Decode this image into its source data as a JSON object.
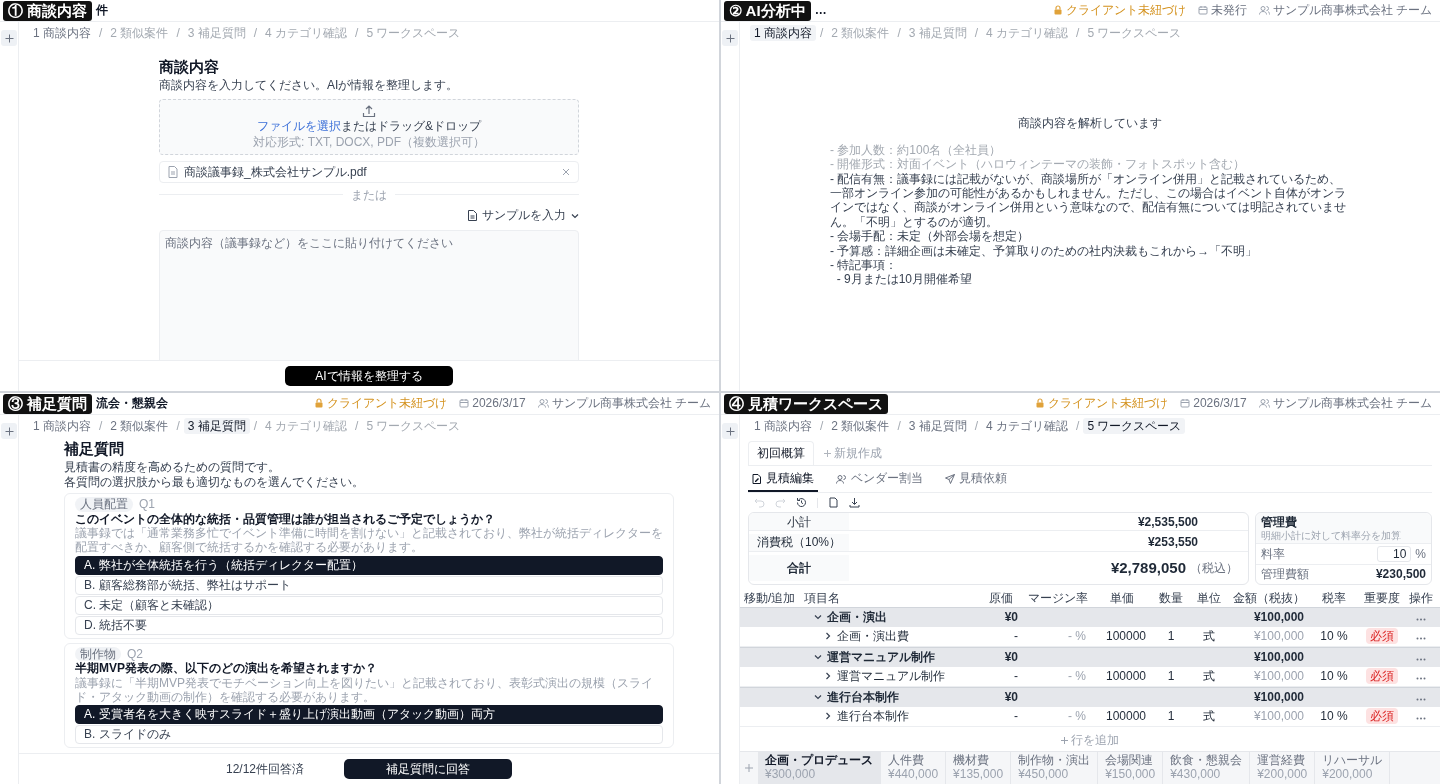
{
  "panels": [
    {
      "kind": "input",
      "label": "① 商談内容",
      "title_tail": "件",
      "step_separator": "/",
      "steps": [
        {
          "label": "1 商談内容",
          "selected": false,
          "disabled": false
        },
        {
          "label": "2 類似案件",
          "selected": false,
          "disabled": true
        },
        {
          "label": "3 補足質問",
          "selected": false,
          "disabled": true
        },
        {
          "label": "4 カテゴリ確認",
          "selected": false,
          "disabled": true
        },
        {
          "label": "5 ワークスペース",
          "selected": false,
          "disabled": true
        }
      ],
      "heading": "商談内容",
      "description": "商談内容を入力してください。AIが情報を整理します。",
      "dropzone": {
        "link": "ファイルを選択",
        "text": "またはドラッグ&ドロップ",
        "hint": "対応形式: TXT, DOCX, PDF（複数選択可）"
      },
      "file": {
        "name": "商談議事録_株式会社サンプル.pdf"
      },
      "divider": "または",
      "sample_button": "サンプルを入力",
      "textarea": {
        "placeholder": "商談内容（議事録など）をここに貼り付けてください"
      },
      "footer_button": "AIで情報を整理する"
    },
    {
      "kind": "analyzing",
      "label": "② AI分析中",
      "title_tail": "…",
      "step_separator": "/",
      "header_items": [
        {
          "kind": "client",
          "text": "クライアント未紐づけ"
        },
        {
          "kind": "date",
          "text": "未発行"
        },
        {
          "kind": "team",
          "text": "サンプル商事株式会社 チーム"
        }
      ],
      "steps": [
        {
          "label": "1 商談内容",
          "selected": true,
          "disabled": false
        },
        {
          "label": "2 類似案件",
          "selected": false,
          "disabled": true
        },
        {
          "label": "3 補足質問",
          "selected": false,
          "disabled": true
        },
        {
          "label": "4 カテゴリ確認",
          "selected": false,
          "disabled": true
        },
        {
          "label": "5 ワークスペース",
          "selected": false,
          "disabled": true
        }
      ],
      "heading": "商談内容を解析しています",
      "lines": [
        {
          "text": "- 参加人数：約100名（全社員）",
          "faded": true
        },
        {
          "text": "- 開催形式：対面イベント（ハロウィンテーマの装飾・フォトスポット含む）",
          "faded": true
        },
        {
          "text": "- 配信有無：議事録には記載がないが、商談場所が「オンライン併用」と記載されているため、一部オンライン参加の可能性があるかもしれません。ただし、この場合はイベント自体がオンラインではなく、商談がオンライン併用という意味なので、配信有無については明記されていません。「不明」とするのが適切。",
          "faded": false
        },
        {
          "text": "- 会場手配：未定（外部会場を想定）",
          "faded": false
        },
        {
          "text": "- 予算感：詳細企画は未確定、予算取りのための社内決裁もこれから→「不明」",
          "faded": false
        },
        {
          "text": "- 特記事項：",
          "faded": false
        },
        {
          "text": "  - 9月または10月開催希望",
          "faded": false
        }
      ]
    },
    {
      "kind": "questions",
      "label": "③ 補足質問",
      "title_tail": "流会・懇親会",
      "step_separator": "/",
      "header_items": [
        {
          "kind": "client",
          "text": "クライアント未紐づけ"
        },
        {
          "kind": "date",
          "text": "2026/3/17"
        },
        {
          "kind": "team",
          "text": "サンプル商事株式会社 チーム"
        }
      ],
      "steps": [
        {
          "label": "1 商談内容",
          "selected": false,
          "disabled": false
        },
        {
          "label": "2 類似案件",
          "selected": false,
          "disabled": false
        },
        {
          "label": "3 補足質問",
          "selected": true,
          "disabled": false
        },
        {
          "label": "4 カテゴリ確認",
          "selected": false,
          "disabled": true
        },
        {
          "label": "5 ワークスペース",
          "selected": false,
          "disabled": true
        }
      ],
      "heading": "補足質問",
      "description_lines": [
        "見積書の精度を高めるための質問です。",
        "各質問の選択肢から最も適切なものを選んでください。"
      ],
      "questions": [
        {
          "tag": "人員配置",
          "number": "Q1",
          "question": "このイベントの全体的な統括・品質管理は誰が担当されるご予定でしょうか？",
          "note": "議事録では「通常業務多忙でイベント準備に時間を割けない」と記載されており、弊社が統括ディレクターを配置すべきか、顧客側で統括するかを確認する必要があります。",
          "options": [
            {
              "label": "A. 弊社が全体統括を行う（統括ディレクター配置）",
              "selected": true
            },
            {
              "label": "B. 顧客総務部が統括、弊社はサポート",
              "selected": false
            },
            {
              "label": "C. 未定（顧客と未確認）",
              "selected": false
            },
            {
              "label": "D. 統括不要",
              "selected": false
            }
          ]
        },
        {
          "tag": "制作物",
          "number": "Q2",
          "question": "半期MVP発表の際、以下のどの演出を希望されますか？",
          "note": "議事録に「半期MVP発表でモチベーション向上を図りたい」と記載されており、表彰式演出の規模（スライド・アタック動画の制作）を確認する必要があります。",
          "options": [
            {
              "label": "A. 受賞者名を大きく映すスライド＋盛り上げ演出動画（アタック動画）両方",
              "selected": true
            },
            {
              "label": "B. スライドのみ",
              "selected": false
            }
          ]
        }
      ],
      "answered": "12/12件回答済",
      "footer_button": "補足質問に回答"
    },
    {
      "kind": "workspace",
      "label": "④ 見積ワークスペース",
      "step_separator": "/",
      "header_items": [
        {
          "kind": "client",
          "text": "クライアント未紐づけ"
        },
        {
          "kind": "date",
          "text": "2026/3/17"
        },
        {
          "kind": "team",
          "text": "サンプル商事株式会社 チーム"
        }
      ],
      "steps": [
        {
          "label": "1 商談内容",
          "selected": false,
          "disabled": false
        },
        {
          "label": "2 類似案件",
          "selected": false,
          "disabled": false
        },
        {
          "label": "3 補足質問",
          "selected": false,
          "disabled": false
        },
        {
          "label": "4 カテゴリ確認",
          "selected": false,
          "disabled": false
        },
        {
          "label": "5 ワークスペース",
          "selected": true,
          "disabled": false
        }
      ],
      "estimate_tabs": [
        {
          "label": "初回概算",
          "selected": true
        }
      ],
      "new_tab": "新規作成",
      "sub_tabs": [
        {
          "label": "見積編集",
          "selected": true
        },
        {
          "label": "ベンダー割当",
          "selected": false
        },
        {
          "label": "見積依頼",
          "selected": false
        }
      ],
      "toolbar_buttons": [
        {
          "kind": "undo",
          "disabled": true
        },
        {
          "kind": "redo",
          "disabled": true
        },
        {
          "kind": "history",
          "disabled": false
        },
        {
          "kind": "copy",
          "disabled": false
        },
        {
          "kind": "download",
          "disabled": false
        }
      ],
      "summary": [
        {
          "kind": "normal",
          "label": "小計",
          "value": "¥2,535,500"
        },
        {
          "kind": "normal",
          "label": "消費税（10%）",
          "value": "¥253,550"
        },
        {
          "kind": "total",
          "label": "合計",
          "value": "¥2,789,050",
          "note": "（税込）"
        }
      ],
      "fee": {
        "title": "管理費",
        "hint": "明細小計に対して料率分を加算",
        "rate_label": "料率",
        "rate_value": "10",
        "rate_unit": "%",
        "amount_label": "管理費額",
        "amount": "¥230,500"
      },
      "columns": [
        "移動/追加",
        "項目名",
        "原価",
        "マージン率",
        "単価",
        "数量",
        "単位",
        "金額（税抜）",
        "税率",
        "重要度",
        "操作"
      ],
      "rows": [
        {
          "kind": "group",
          "expanded": true,
          "name": "企画・演出",
          "cost": "¥0",
          "amount": "¥100,000"
        },
        {
          "kind": "item",
          "expanded": false,
          "name": "企画・演出費",
          "cost": "-",
          "margin": "- %",
          "unit_price": "100000",
          "qty": "1",
          "unit": "式",
          "amount": "¥100,000",
          "tax": "10 %",
          "importance": "必須"
        },
        {
          "kind": "group",
          "expanded": true,
          "name": "運営マニュアル制作",
          "cost": "¥0",
          "amount": "¥100,000"
        },
        {
          "kind": "item",
          "expanded": false,
          "name": "運営マニュアル制作",
          "cost": "-",
          "margin": "- %",
          "unit_price": "100000",
          "qty": "1",
          "unit": "式",
          "amount": "¥100,000",
          "tax": "10 %",
          "importance": "必須"
        },
        {
          "kind": "group",
          "expanded": true,
          "name": "進行台本制作",
          "cost": "¥0",
          "amount": "¥100,000"
        },
        {
          "kind": "item",
          "expanded": false,
          "name": "進行台本制作",
          "cost": "-",
          "margin": "- %",
          "unit_price": "100000",
          "qty": "1",
          "unit": "式",
          "amount": "¥100,000",
          "tax": "10 %",
          "importance": "必須"
        }
      ],
      "add_row": "行を追加",
      "bottom_tabs": [
        {
          "name": "企画・プロデュース",
          "amount": "¥300,000",
          "selected": true
        },
        {
          "name": "人件費",
          "amount": "¥440,000",
          "selected": false
        },
        {
          "name": "機材費",
          "amount": "¥135,000",
          "selected": false
        },
        {
          "name": "制作物・演出",
          "amount": "¥450,000",
          "selected": false
        },
        {
          "name": "会場関連",
          "amount": "¥150,000",
          "selected": false
        },
        {
          "name": "飲食・懇親会",
          "amount": "¥430,000",
          "selected": false
        },
        {
          "name": "運営経費",
          "amount": "¥200,000",
          "selected": false
        },
        {
          "name": "リハーサル",
          "amount": "¥200,000",
          "selected": false
        }
      ]
    }
  ]
}
